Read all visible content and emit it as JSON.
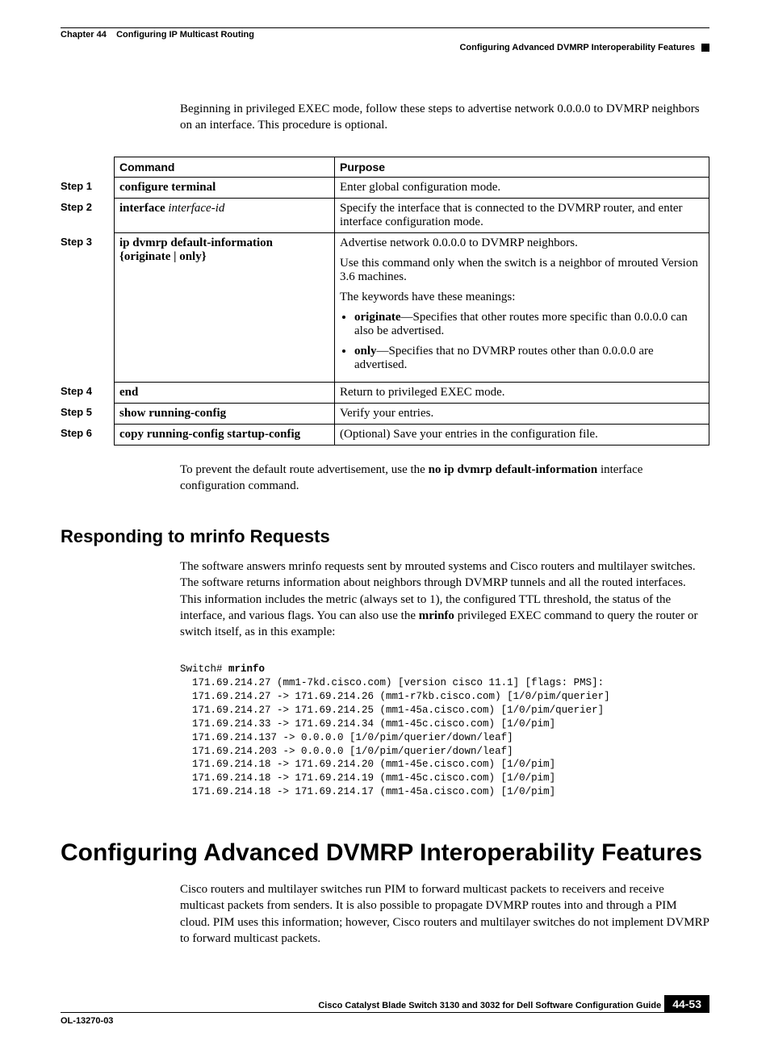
{
  "header": {
    "chapter": "Chapter 44",
    "chapter_title": "Configuring IP Multicast Routing",
    "section": "Configuring Advanced DVMRP Interoperability Features"
  },
  "intro": "Beginning in privileged EXEC mode, follow these steps to advertise network 0.0.0.0 to DVMRP neighbors on an interface. This procedure is optional.",
  "table": {
    "head_command": "Command",
    "head_purpose": "Purpose",
    "rows": [
      {
        "step": "Step 1",
        "cmd_bold": "configure terminal",
        "cmd_italic": "",
        "cmd_line2_bold": "",
        "purpose_html": "<p>Enter global configuration mode.</p>"
      },
      {
        "step": "Step 2",
        "cmd_bold": "interface",
        "cmd_italic": " interface-id",
        "cmd_line2_bold": "",
        "purpose_html": "<p>Specify the interface that is connected to the DVMRP router, and enter interface configuration mode.</p>"
      },
      {
        "step": "Step 3",
        "cmd_bold": "ip dvmrp default-information",
        "cmd_italic": "",
        "cmd_line2_bold": "{originate | only}",
        "purpose_html": "<p>Advertise network 0.0.0.0 to DVMRP neighbors.</p><p>Use this command only when the switch is a neighbor of mrouted Version 3.6 machines.</p><p>The keywords have these meanings:</p><ul><li><span class='b'>originate</span>—Specifies that other routes more specific than 0.0.0.0 can also be advertised.</li><li><span class='b'>only</span>—Specifies that no DVMRP routes other than 0.0.0.0 are advertised.</li></ul>"
      },
      {
        "step": "Step 4",
        "cmd_bold": "end",
        "cmd_italic": "",
        "cmd_line2_bold": "",
        "purpose_html": "<p>Return to privileged EXEC mode.</p>"
      },
      {
        "step": "Step 5",
        "cmd_bold": "show running-config",
        "cmd_italic": "",
        "cmd_line2_bold": "",
        "purpose_html": "<p>Verify your entries.</p>"
      },
      {
        "step": "Step 6",
        "cmd_bold": "copy running-config startup-config",
        "cmd_italic": "",
        "cmd_line2_bold": "",
        "purpose_html": "<p>(Optional) Save your entries in the configuration file.</p>"
      }
    ]
  },
  "after_table_pre": "To prevent the default route advertisement, use the ",
  "after_table_bold": "no ip dvmrp default-information",
  "after_table_post": " interface configuration command.",
  "h2": "Responding to mrinfo Requests",
  "mrinfo_para_pre": "The software answers mrinfo requests sent by mrouted systems and Cisco routers and multilayer switches. The software returns information about neighbors through DVMRP tunnels and all the routed interfaces. This information includes the metric (always set to 1), the configured TTL threshold, the status of the interface, and various flags. You can also use the ",
  "mrinfo_para_bold": "mrinfo",
  "mrinfo_para_post": " privileged EXEC command to query the router or switch itself, as in this example:",
  "code_prompt": "Switch# ",
  "code_cmd": "mrinfo",
  "code_body": "  171.69.214.27 (mm1-7kd.cisco.com) [version cisco 11.1] [flags: PMS]:\n  171.69.214.27 -> 171.69.214.26 (mm1-r7kb.cisco.com) [1/0/pim/querier]\n  171.69.214.27 -> 171.69.214.25 (mm1-45a.cisco.com) [1/0/pim/querier]\n  171.69.214.33 -> 171.69.214.34 (mm1-45c.cisco.com) [1/0/pim]\n  171.69.214.137 -> 0.0.0.0 [1/0/pim/querier/down/leaf]\n  171.69.214.203 -> 0.0.0.0 [1/0/pim/querier/down/leaf]\n  171.69.214.18 -> 171.69.214.20 (mm1-45e.cisco.com) [1/0/pim]\n  171.69.214.18 -> 171.69.214.19 (mm1-45c.cisco.com) [1/0/pim]\n  171.69.214.18 -> 171.69.214.17 (mm1-45a.cisco.com) [1/0/pim]",
  "h1": "Configuring Advanced DVMRP Interoperability Features",
  "adv_para": "Cisco routers and multilayer switches run PIM to forward multicast packets to receivers and receive multicast packets from senders. It is also possible to propagate DVMRP routes into and through a PIM cloud. PIM uses this information; however, Cisco routers and multilayer switches do not implement DVMRP to forward multicast packets.",
  "footer": {
    "book": "Cisco Catalyst Blade Switch 3130 and 3032 for Dell Software Configuration Guide",
    "doc": "OL-13270-03",
    "page": "44-53"
  }
}
